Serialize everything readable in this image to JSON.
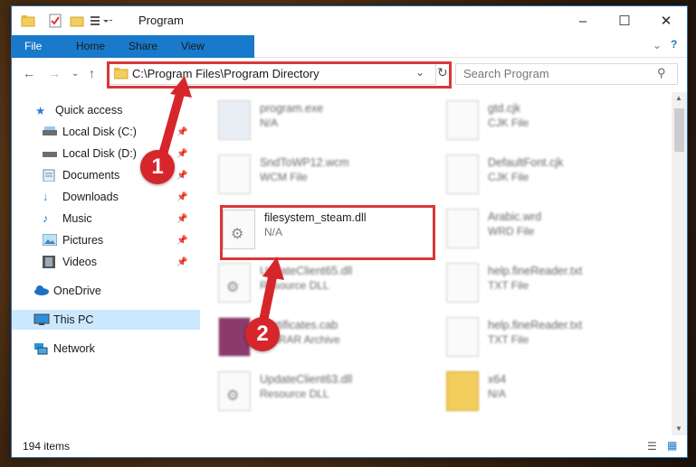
{
  "window": {
    "title": "Program"
  },
  "ribbon": {
    "tabs": [
      "File",
      "Home",
      "Share",
      "View"
    ]
  },
  "nav": {
    "address": "C:\\Program Files\\Program Directory",
    "search_placeholder": "Search Program"
  },
  "sidebar": {
    "items": [
      {
        "label": "Quick access",
        "icon": "star-icon"
      },
      {
        "label": "Local Disk (C:)",
        "icon": "drive-icon"
      },
      {
        "label": "Local Disk (D:)",
        "icon": "drive-icon"
      },
      {
        "label": "Documents",
        "icon": "documents-icon"
      },
      {
        "label": "Downloads",
        "icon": "download-icon"
      },
      {
        "label": "Music",
        "icon": "music-icon"
      },
      {
        "label": "Pictures",
        "icon": "pictures-icon"
      },
      {
        "label": "Videos",
        "icon": "videos-icon"
      },
      {
        "label": "OneDrive",
        "icon": "cloud-icon"
      },
      {
        "label": "This PC",
        "icon": "computer-icon"
      },
      {
        "label": "Network",
        "icon": "network-icon"
      }
    ]
  },
  "files": {
    "left": [
      {
        "name": "program.exe",
        "type": "N/A"
      },
      {
        "name": "SndToWP12.wcm",
        "type": "WCM File"
      },
      {
        "name": "filesystem_steam.dll",
        "type": "N/A"
      },
      {
        "name": "UpdateClient65.dll",
        "type": "Resource DLL"
      },
      {
        "name": "Certificates.cab",
        "type": "WinRAR Archive"
      },
      {
        "name": "UpdateClient63.dll",
        "type": "Resource DLL"
      }
    ],
    "right": [
      {
        "name": "gtd.cjk",
        "type": "CJK File"
      },
      {
        "name": "DefaultFont.cjk",
        "type": "CJK File"
      },
      {
        "name": "Arabic.wrd",
        "type": "WRD File"
      },
      {
        "name": "help.fineReader.txt",
        "type": "TXT File"
      },
      {
        "name": "help.fineReader.txt",
        "type": "TXT File"
      },
      {
        "name": "x64",
        "type": "N/A"
      }
    ]
  },
  "status": {
    "count": "194 items"
  },
  "callouts": [
    "1",
    "2"
  ],
  "colors": {
    "accent": "#1979ca",
    "highlight": "#d9373a"
  }
}
